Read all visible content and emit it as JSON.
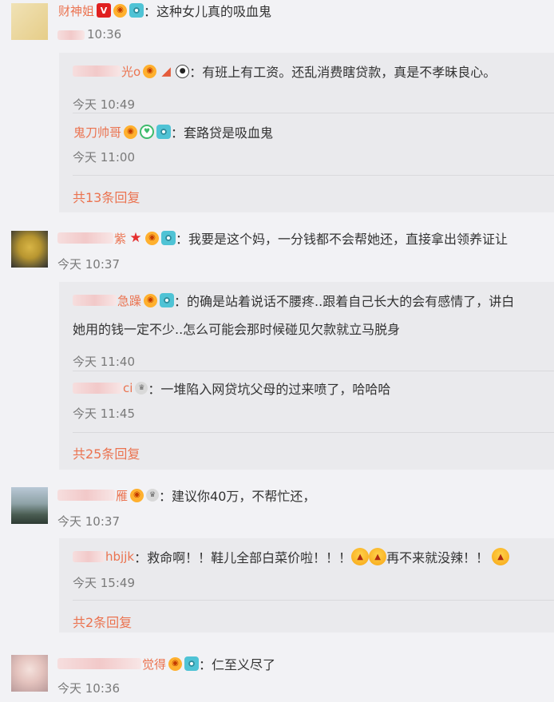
{
  "comments": [
    {
      "name_tail": "财神姐",
      "text": "：这种女儿真的吸血鬼",
      "time": "10:36",
      "replies": [
        {
          "name_tail": "光o",
          "text": "：有班上有工资。还乱消费瞎贷款，真是不孝昧良心。",
          "time": "今天 10:49"
        },
        {
          "name_tail": "鬼刀帅哥",
          "text": "：套路贷是吸血鬼",
          "time": "今天 11:00"
        }
      ],
      "more": "共13条回复"
    },
    {
      "name_tail": "紫",
      "text": "：我要是这个妈，一分钱都不会帮她还，直接拿出领养证让",
      "time": "今天 10:37",
      "replies": [
        {
          "name_tail": "急躁",
          "text": "：的确是站着说话不腰疼..跟着自己长大的会有感情了，讲白",
          "line2": "她用的钱一定不少..怎么可能会那时候碰见欠款就立马脱身",
          "time": "今天 11:40"
        },
        {
          "name_tail": "ci",
          "text": "：一堆陷入网贷坑父母的过来喷了，哈哈哈",
          "time": "今天 11:45"
        }
      ],
      "more": "共25条回复"
    },
    {
      "name_tail": "雁",
      "text": "：建议你40万，不帮忙还，",
      "time": "今天 10:37",
      "replies": [
        {
          "name_tail": "hbjjk",
          "text_a": "：救命啊！！鞋儿全部白菜价啦！！！",
          "text_b": "再不来就没辣！！",
          "time": "今天 15:49"
        }
      ],
      "more": "共2条回复"
    },
    {
      "name_tail": "觉得",
      "text": "：仁至义尽了",
      "time": "今天 10:36"
    }
  ],
  "icons": {
    "vip": "V",
    "verified_color": "#e02020",
    "link_color": "#eb7350",
    "camera": "camera-badge-icon",
    "medal": "medal-icon"
  }
}
